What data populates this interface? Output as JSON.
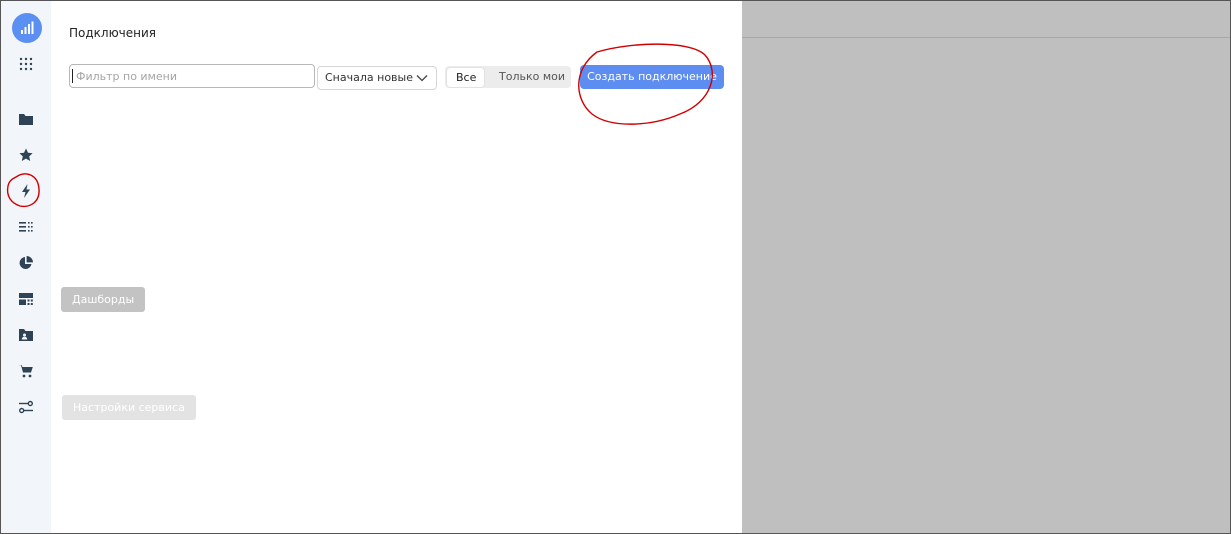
{
  "panel": {
    "title": "Подключения",
    "filter_placeholder": "Фильтр по имени",
    "sort": {
      "selected": "Сначала новые"
    },
    "scope_tabs": [
      "Все",
      "Только мои"
    ],
    "create_button": "Создать подключение"
  },
  "tooltips": {
    "dashboards": "Дашборды",
    "settings": "Настройки сервиса"
  },
  "sidebar": {
    "icons": [
      "logo-chart-icon",
      "apps-grid-icon",
      "folder-icon",
      "star-icon",
      "connections-bolt-icon",
      "datasets-icon",
      "charts-pie-icon",
      "dashboards-icon",
      "user-folder-icon",
      "cart-icon",
      "settings-sliders-icon"
    ]
  },
  "colors": {
    "accent": "#5b8ff2",
    "icon": "#2f4357",
    "annotation": "#d10000"
  }
}
